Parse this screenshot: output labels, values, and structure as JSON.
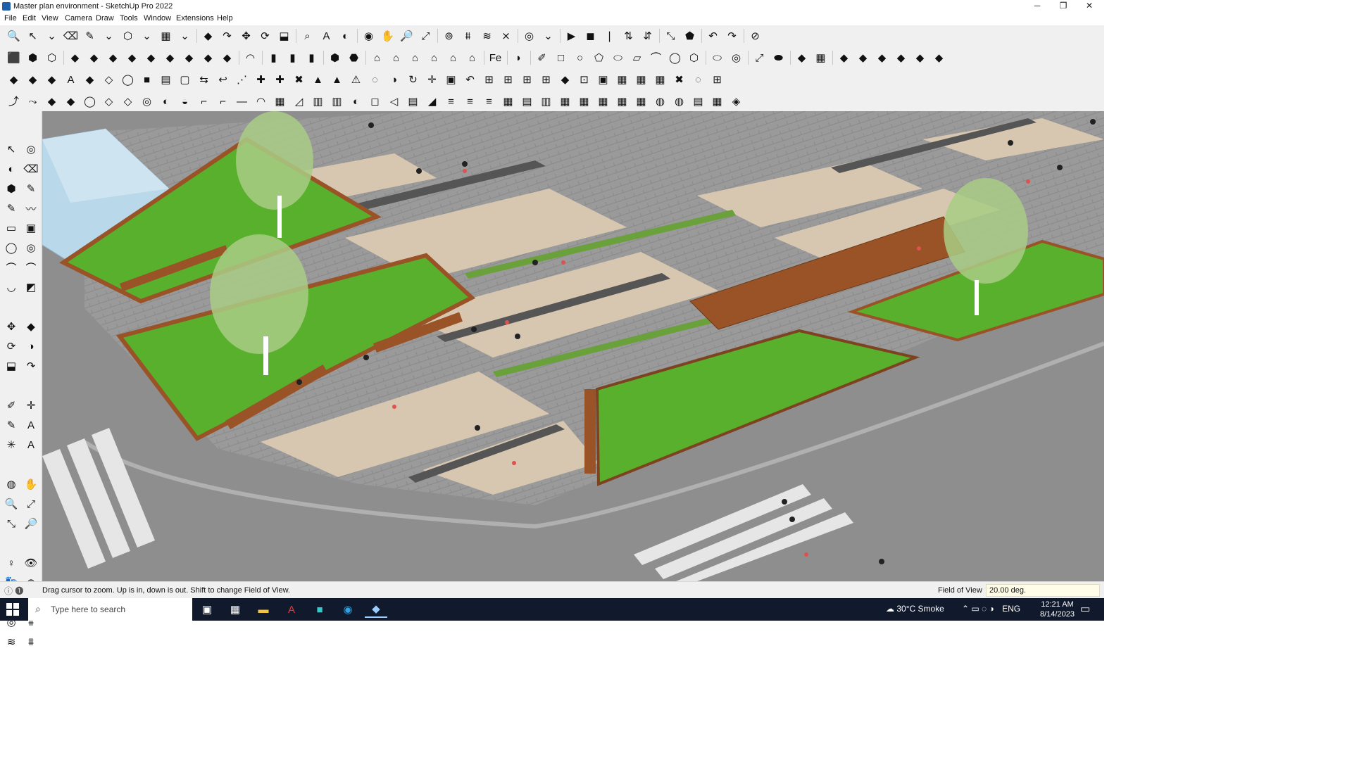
{
  "window": {
    "title": "Master plan environment - SketchUp Pro 2022",
    "minimize": "─",
    "restore": "❐",
    "close": "✕"
  },
  "menu": [
    "File",
    "Edit",
    "View",
    "Camera",
    "Draw",
    "Tools",
    "Window",
    "Extensions",
    "Help"
  ],
  "toolbars": {
    "row1": [
      "🔍",
      "↖",
      "⌄",
      "⌫",
      "✎",
      "⌄",
      "⬡",
      "⌄",
      "▦",
      "⌄",
      "|",
      "◆",
      "↷",
      "✥",
      "⟳",
      "⬓",
      "|",
      "⌕",
      "A",
      "◐",
      "|",
      "◉",
      "✋",
      "🔎",
      "⤢",
      "|",
      "⊚",
      "⩩",
      "≋",
      "⨯",
      "|",
      "◎",
      "⌄",
      "|",
      "▶",
      "◼",
      "❘",
      "⇅",
      "⇵",
      "|",
      "⤡",
      "⬟",
      "|",
      "↶",
      "↷",
      "|",
      "⊘"
    ],
    "row2": [
      "⬛",
      "⬢",
      "⬡",
      "|",
      "◆",
      "◆",
      "◆",
      "◆",
      "◆",
      "◆",
      "◆",
      "◆",
      "◆",
      "|",
      "◠",
      "|",
      "▮",
      "▮",
      "▮",
      "|",
      "⬢",
      "⬣",
      "|",
      "⌂",
      "⌂",
      "⌂",
      "⌂",
      "⌂",
      "⌂",
      "|",
      "Fe",
      "|",
      "◗",
      "|",
      "✐",
      "□",
      "○",
      "⬠",
      "⬭",
      "▱",
      "⌒",
      "◯",
      "⬡",
      "|",
      "⬭",
      "◎",
      "|",
      "⤢",
      "⬬",
      "|",
      "◆",
      "▦",
      "|",
      "◆",
      "◆",
      "◆",
      "◆",
      "◆",
      "◆"
    ],
    "row3": [
      "◆",
      "◆",
      "◆",
      "A",
      "◆",
      "◇",
      "◯",
      "■",
      "▤",
      "▢",
      "⇆",
      "↩",
      "⋰",
      "✚",
      "✚",
      "✖",
      "▲",
      "▲",
      "⚠",
      "◌",
      "◑",
      "↻",
      "✛",
      "▣",
      "↶",
      "⊞",
      "⊞",
      "⊞",
      "⊞",
      "◆",
      "⊡",
      "▣",
      "▦",
      "▦",
      "▦",
      "✖",
      "◌",
      "⊞"
    ],
    "row4": [
      "⤴",
      "⤳",
      "◆",
      "◆",
      "◯",
      "◇",
      "◇",
      "◎",
      "◐",
      "◒",
      "⌐",
      "⌐",
      "—",
      "◠",
      "▦",
      "◿",
      "▥",
      "▥",
      "◐",
      "◻",
      "◁",
      "▤",
      "◢",
      "≡",
      "≡",
      "≡",
      "▦",
      "▤",
      "▥",
      "▦",
      "▦",
      "▦",
      "▦",
      "▦",
      "◍",
      "◍",
      "▤",
      "▦",
      "◈"
    ]
  },
  "left_tools": [
    "↖",
    "◎",
    "◐",
    "⌫",
    "⬢",
    "✎",
    "✎",
    "〰",
    "▭",
    "▣",
    "◯",
    "◎",
    "⌒",
    "⌒",
    "◡",
    "◩",
    "gap",
    "✥",
    "◆",
    "⟳",
    "◑",
    "⬓",
    "↷",
    "gap",
    "✐",
    "✛",
    "✎",
    "A",
    "✳",
    "A",
    "gap",
    "◍",
    "✋",
    "🔍",
    "⤢",
    "⤡",
    "🔎",
    "gap",
    "♀",
    "👁",
    "👣",
    "⊕",
    "gap",
    "◎",
    "⩩",
    "≋",
    "⩩"
  ],
  "status": {
    "message": "Drag cursor to zoom.  Up is in, down is out. Shift to change Field of View.",
    "vcb_label": "Field of View",
    "vcb_value": "20.00 deg."
  },
  "taskbar": {
    "search_placeholder": "Type here to search",
    "weather": "30°C  Smoke",
    "lang": "ENG",
    "time": "12:21 AM",
    "date": "8/14/2023"
  },
  "colors": {
    "grass": "#58b02c",
    "wood": "#9a5227",
    "paving_light": "#d9c8b1",
    "paving_grey": "#969696",
    "asphalt": "#8c8c8c",
    "tree": "#a9cc85",
    "glass": "#b9d8ea"
  }
}
